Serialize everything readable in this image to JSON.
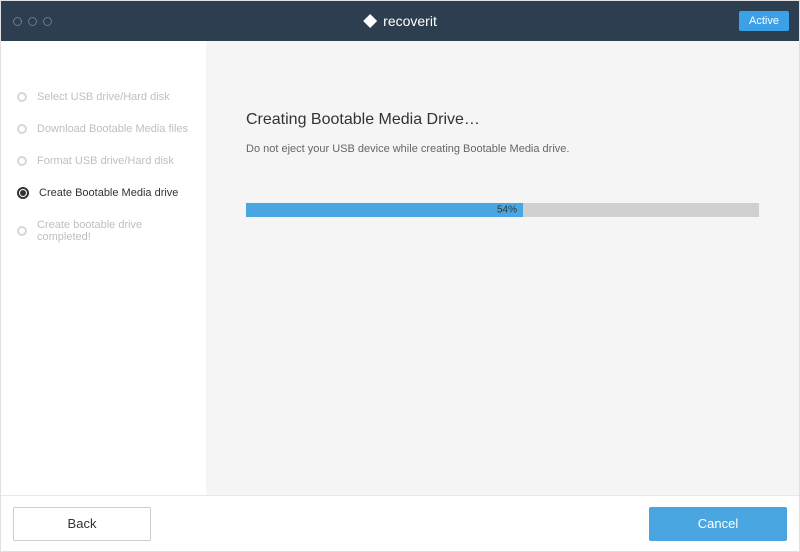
{
  "header": {
    "app_name": "recoverit",
    "badge_label": "Active"
  },
  "sidebar": {
    "steps": [
      {
        "label": "Select USB drive/Hard disk",
        "active": false
      },
      {
        "label": "Download Bootable Media files",
        "active": false
      },
      {
        "label": "Format USB drive/Hard disk",
        "active": false
      },
      {
        "label": "Create Bootable Media drive",
        "active": true
      },
      {
        "label": "Create bootable drive completed!",
        "active": false
      }
    ]
  },
  "main": {
    "title": "Creating Bootable Media Drive…",
    "subtitle": "Do not eject your USB device while creating Bootable Media drive.",
    "progress_percent": 54,
    "progress_label": "54%"
  },
  "footer": {
    "back_label": "Back",
    "cancel_label": "Cancel"
  },
  "colors": {
    "accent": "#4aa6e0",
    "titlebar": "#2c3e50"
  }
}
